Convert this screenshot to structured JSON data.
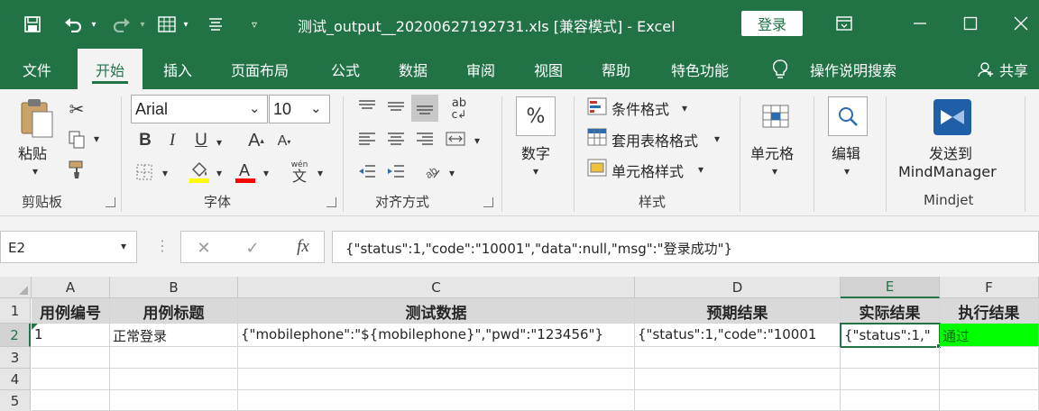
{
  "titlebar": {
    "title": "测试_output__20200627192731.xls  [兼容模式]  -  Excel",
    "login_label": "登录",
    "save_icon": "save-icon",
    "undo_icon": "undo-icon",
    "redo_icon": "redo-icon",
    "restore_icon": "ribbon-display-icon",
    "minimize_icon": "minimize-icon",
    "maximize_icon": "maximize-icon",
    "close_icon": "close-icon"
  },
  "tabs": [
    {
      "label": "文件"
    },
    {
      "label": "开始"
    },
    {
      "label": "插入"
    },
    {
      "label": "页面布局"
    },
    {
      "label": "公式"
    },
    {
      "label": "数据"
    },
    {
      "label": "审阅"
    },
    {
      "label": "视图"
    },
    {
      "label": "帮助"
    },
    {
      "label": "特色功能"
    },
    {
      "label": "操作说明搜索"
    },
    {
      "label": "共享"
    }
  ],
  "ribbon": {
    "clipboard": {
      "paste_label": "粘贴",
      "group_label": "剪贴板"
    },
    "font": {
      "font_name": "Arial",
      "font_size": "10",
      "group_label": "字体",
      "wen_label": "wén",
      "wen_char": "文"
    },
    "alignment": {
      "group_label": "对齐方式",
      "wrap_label": "ab"
    },
    "number": {
      "label": "数字",
      "percent": "%"
    },
    "styles": {
      "conditional": "条件格式",
      "table": "套用表格格式",
      "cell_style": "单元格样式",
      "group_label": "样式"
    },
    "cells": {
      "label": "单元格"
    },
    "editing": {
      "label": "编辑"
    },
    "mindjet": {
      "label_line1": "发送到",
      "label_line2": "MindManager",
      "group_label": "Mindjet"
    }
  },
  "formulabar": {
    "namebox": "E2",
    "fx": "fx",
    "formula": "{\"status\":1,\"code\":\"10001\",\"data\":null,\"msg\":\"登录成功\"}"
  },
  "grid": {
    "columns": [
      "A",
      "B",
      "C",
      "D",
      "E",
      "F"
    ],
    "rows": [
      "1",
      "2",
      "3",
      "4",
      "5"
    ],
    "header_row": [
      "用例编号",
      "用例标题",
      "测试数据",
      "预期结果",
      "实际结果",
      "执行结果"
    ],
    "data_row": [
      "1",
      "正常登录",
      "{\"mobilephone\":\"${mobilephone}\",\"pwd\":\"123456\"}",
      "{\"status\":1,\"code\":\"10001",
      "{\"status\":1,\"",
      "通过"
    ]
  },
  "colors": {
    "brand": "#217346",
    "pass_fill": "#00ff00",
    "header_fill": "#d9d9d9"
  }
}
